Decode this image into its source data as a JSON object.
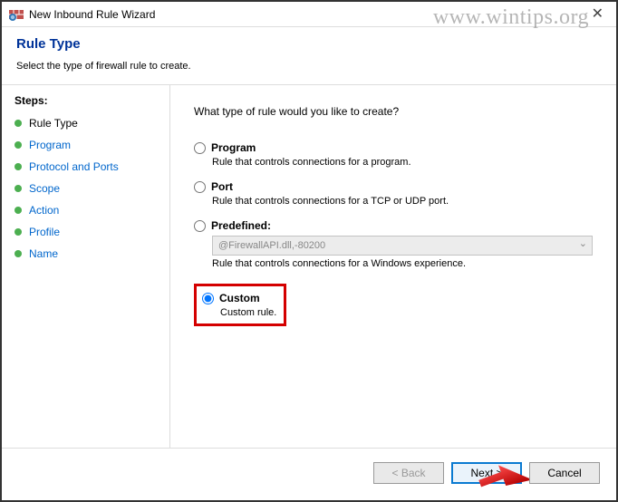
{
  "titlebar": {
    "title": "New Inbound Rule Wizard"
  },
  "watermark": "www.wintips.org",
  "header": {
    "title": "Rule Type",
    "subtitle": "Select the type of firewall rule to create."
  },
  "sidebar": {
    "title": "Steps:",
    "items": [
      {
        "label": "Rule Type",
        "current": true
      },
      {
        "label": "Program"
      },
      {
        "label": "Protocol and Ports"
      },
      {
        "label": "Scope"
      },
      {
        "label": "Action"
      },
      {
        "label": "Profile"
      },
      {
        "label": "Name"
      }
    ]
  },
  "main": {
    "prompt": "What type of rule would you like to create?",
    "options": {
      "program": {
        "label": "Program",
        "desc": "Rule that controls connections for a program."
      },
      "port": {
        "label": "Port",
        "desc": "Rule that controls connections for a TCP or UDP port."
      },
      "predefined": {
        "label": "Predefined:",
        "selected": "@FirewallAPI.dll,-80200",
        "desc": "Rule that controls connections for a Windows experience."
      },
      "custom": {
        "label": "Custom",
        "desc": "Custom rule."
      }
    },
    "selected": "custom"
  },
  "footer": {
    "back": "< Back",
    "next": "Next >",
    "cancel": "Cancel"
  }
}
